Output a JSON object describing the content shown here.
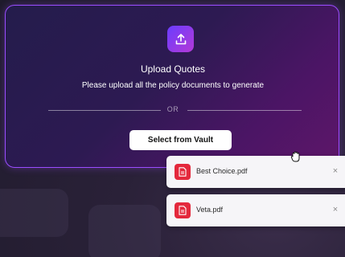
{
  "upload": {
    "title": "Upload Quotes",
    "subtitle": "Please upload all the policy documents to generate",
    "divider_text": "OR",
    "button_label": "Select from Vault",
    "icon": "upload-icon"
  },
  "files": [
    {
      "name": "Best Choice.pdf",
      "icon": "pdf-file-icon",
      "remove_icon": "close-icon"
    },
    {
      "name": "Veta.pdf",
      "icon": "pdf-file-icon",
      "remove_icon": "close-icon"
    }
  ],
  "cursor": {
    "icon": "grab-hand-cursor-icon"
  },
  "colors": {
    "accent": "#9b4dff",
    "pdf_red": "#e4283c",
    "button_bg": "#ffffff"
  }
}
